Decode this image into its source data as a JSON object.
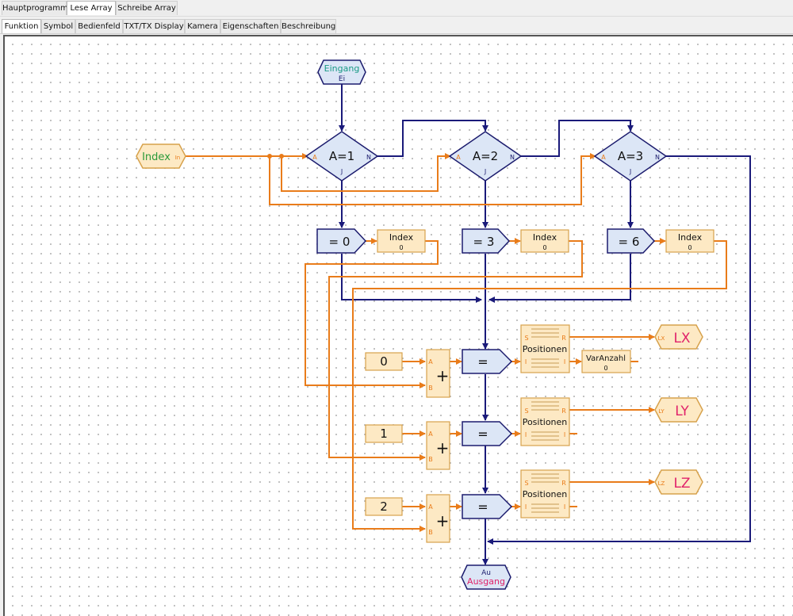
{
  "tabs": [
    "Hauptprogramm",
    "Lese Array",
    "Schreibe Array"
  ],
  "subtabs": [
    "Funktion",
    "Symbol",
    "Bedienfeld",
    "TXT/TX Display",
    "Kamera",
    "Eigenschaften",
    "Beschreibung"
  ],
  "colors": {
    "blueFill": "#dce6f6",
    "blueStroke": "#1c1c6e",
    "blueLine": "#1a1a7a",
    "orangeFill": "#fde9c4",
    "orangeStroke": "#d7a24c",
    "orangeLine": "#e97c1a",
    "teal": "#1a9a86",
    "pink": "#e0226a",
    "green": "#2a9a3a"
  },
  "diagram": {
    "eingang": {
      "title": "Eingang",
      "sub": "Ei"
    },
    "index_input": {
      "label": "Index",
      "port": "In"
    },
    "branches": [
      {
        "label": "A=1",
        "a": "A",
        "n": "N",
        "j": "J"
      },
      {
        "label": "A=2",
        "a": "A",
        "n": "N",
        "j": "J"
      },
      {
        "label": "A=3",
        "a": "A",
        "n": "N",
        "j": "J"
      }
    ],
    "assigns": [
      "= 0",
      "= 3",
      "= 6"
    ],
    "index_vars": [
      {
        "name": "Index",
        "value": "0"
      },
      {
        "name": "Index",
        "value": "0"
      },
      {
        "name": "Index",
        "value": "0"
      }
    ],
    "constants": [
      "0",
      "1",
      "2"
    ],
    "adders": [
      {
        "sign": "+",
        "a": "A",
        "b": "B"
      },
      {
        "sign": "+",
        "a": "A",
        "b": "B"
      },
      {
        "sign": "+",
        "a": "A",
        "b": "B"
      }
    ],
    "equals": [
      "=",
      "=",
      "="
    ],
    "arrays": [
      {
        "name": "Positionen",
        "s": "S",
        "r": "R",
        "i1": "I",
        "i2": "I"
      },
      {
        "name": "Positionen",
        "s": "S",
        "r": "R",
        "i1": "I",
        "i2": "I"
      },
      {
        "name": "Positionen",
        "s": "S",
        "r": "R",
        "i1": "I",
        "i2": "I"
      }
    ],
    "var_anzahl": {
      "name": "VarAnzahl",
      "value": "0"
    },
    "outputs": [
      {
        "label": "LX",
        "port": "LX"
      },
      {
        "label": "LY",
        "port": "LY"
      },
      {
        "label": "LZ",
        "port": "LZ"
      }
    ],
    "ausgang": {
      "title": "Ausgang",
      "sub": "Au"
    }
  }
}
